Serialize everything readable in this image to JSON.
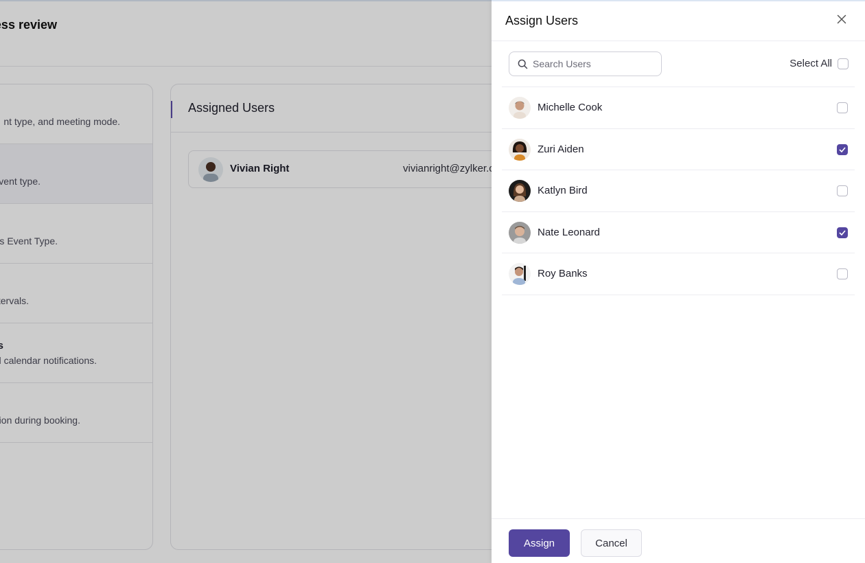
{
  "background": {
    "page_title_fragment": "ess review",
    "settings_sections": [
      {
        "title": "",
        "description": "nt type, and meeting mode.",
        "active": false
      },
      {
        "title": "",
        "description": "s event type.",
        "active": true
      },
      {
        "title": "",
        "description": "r this Event Type.",
        "active": false
      },
      {
        "title": "",
        "description": "intervals.",
        "active": false
      },
      {
        "title": "ces",
        "description": "nd calendar notifications.",
        "active": false
      },
      {
        "title": "",
        "description": "ation during booking.",
        "active": false
      }
    ],
    "assigned_users": {
      "title": "Assigned Users",
      "users": [
        {
          "name": "Vivian Right",
          "email": "vivianright@zylker.com",
          "avatar": "avatar-photo"
        }
      ]
    }
  },
  "drawer": {
    "title": "Assign Users",
    "close_icon": "close-icon",
    "search": {
      "placeholder": "Search Users",
      "value": "",
      "icon": "search-icon"
    },
    "select_all": {
      "label": "Select All",
      "checked": false
    },
    "users": [
      {
        "name": "Michelle Cook",
        "checked": false,
        "avatar": "avatar-photo"
      },
      {
        "name": "Zuri Aiden",
        "checked": true,
        "avatar": "avatar-photo"
      },
      {
        "name": "Katlyn Bird",
        "checked": false,
        "avatar": "avatar-photo"
      },
      {
        "name": "Nate Leonard",
        "checked": true,
        "avatar": "avatar-photo"
      },
      {
        "name": "Roy Banks",
        "checked": false,
        "avatar": "avatar-photo"
      }
    ],
    "footer": {
      "assign_label": "Assign",
      "cancel_label": "Cancel"
    }
  },
  "colors": {
    "accent": "#54469f",
    "overlay": "rgba(0,0,0,0.2)"
  }
}
